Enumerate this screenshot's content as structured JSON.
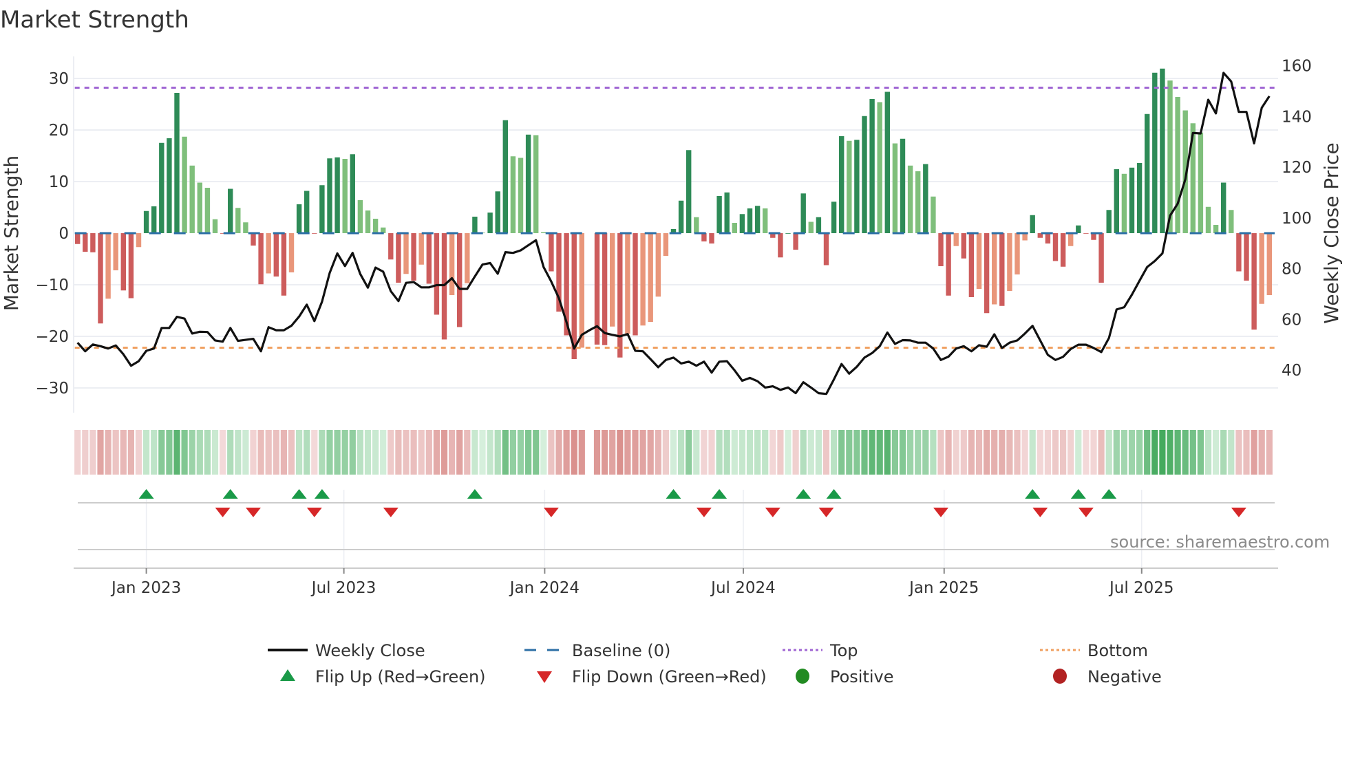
{
  "chart_data": {
    "type": "bar",
    "title": "Market Strength",
    "ylabel": "Market Strength",
    "y2label": "Weekly Close Price",
    "ylim": [
      -35,
      35
    ],
    "y_ticks": [
      30,
      20,
      10,
      0,
      -10,
      -20,
      -30
    ],
    "y_tick_labels": [
      "30",
      "20",
      "10",
      "0",
      "−10",
      "−20",
      "−30"
    ],
    "y2lim": [
      30,
      165
    ],
    "y2_ticks": [
      40,
      60,
      80,
      100,
      120,
      140,
      160
    ],
    "y2_tick_labels": [
      "40",
      "60",
      "80",
      "100",
      "120",
      "140",
      "160"
    ],
    "x_start_week": "2022-10-30",
    "x_ticks": [
      {
        "date": "2023-01-01",
        "label": "Jan 2023"
      },
      {
        "date": "2023-07-01",
        "label": "Jul 2023"
      },
      {
        "date": "2024-01-01",
        "label": "Jan 2024"
      },
      {
        "date": "2024-07-01",
        "label": "Jul 2024"
      },
      {
        "date": "2025-01-01",
        "label": "Jan 2025"
      },
      {
        "date": "2025-07-01",
        "label": "Jul 2025"
      }
    ],
    "top_level": 28.2,
    "bottom_level": -22.2,
    "baseline": 0,
    "grid": true,
    "legend_position": "bottom",
    "series": [
      {
        "name": "Market Strength",
        "values": [
          -2.1,
          -3.6,
          -3.7,
          -17.5,
          -12.7,
          -7.2,
          -11.1,
          -12.6,
          -2.7,
          4.3,
          5.2,
          17.5,
          18.4,
          27.2,
          18.7,
          13.1,
          9.8,
          8.8,
          2.7,
          -0.1,
          8.6,
          4.9,
          2.1,
          -2.4,
          -9.9,
          -7.8,
          -8.4,
          -12.1,
          -7.6,
          5.6,
          8.2,
          -0.1,
          9.3,
          14.5,
          14.7,
          14.4,
          15.3,
          6.4,
          4.4,
          2.8,
          1.1,
          -5.1,
          -9.6,
          -7.9,
          -9.2,
          -6.1,
          -9.8,
          -15.8,
          -20.6,
          -12.0,
          -18.2,
          -9.7,
          3.2,
          0.1,
          4.0,
          8.1,
          21.9,
          14.9,
          14.6,
          19.1,
          19.0,
          0.2,
          -7.4,
          -15.2,
          -19.8,
          -24.4,
          -22.2,
          null,
          -21.6,
          -21.7,
          -18.1,
          -24.1,
          -19.5,
          -19.8,
          -17.9,
          -17.2,
          -12.3,
          -4.4,
          0.8,
          6.3,
          16.1,
          3.1,
          -1.6,
          -2.0,
          7.2,
          7.9,
          2.0,
          3.7,
          4.8,
          5.3,
          4.8,
          -0.9,
          -4.7,
          0,
          -3.2,
          7.7,
          2.2,
          3.1,
          -6.2,
          6.1,
          18.8,
          17.9,
          18.1,
          22.7,
          26.0,
          25.4,
          27.4,
          17.4,
          18.3,
          13.1,
          12.0,
          13.4,
          7.1,
          -6.4,
          -12.1,
          -2.5,
          -4.9,
          -12.4,
          -10.8,
          -15.5,
          -13.8,
          -14.1,
          -11.2,
          -8.0,
          -1.4,
          3.5,
          -0.9,
          -2.0,
          -5.4,
          -6.5,
          -2.5,
          1.5,
          -0.1,
          -1.3,
          -9.6,
          4.5,
          12.4,
          11.5,
          12.7,
          13.6,
          23.1,
          31.1,
          31.9,
          29.6,
          26.4,
          23.8,
          21.3,
          19.5,
          5.1,
          1.6,
          9.8,
          4.5,
          -7.4,
          -9.2,
          -18.7,
          -13.7,
          -12.0
        ]
      },
      {
        "name": "Weekly Close",
        "axis": "right",
        "values": [
          50.8,
          47.4,
          50.1,
          49.4,
          48.5,
          49.7,
          46.2,
          41.7,
          43.5,
          47.6,
          48.5,
          56.6,
          56.6,
          61.0,
          60.3,
          54.4,
          55.1,
          55.0,
          51.7,
          51.2,
          56.6,
          51.5,
          51.9,
          52.3,
          47.4,
          56.9,
          55.7,
          55.7,
          57.5,
          61.1,
          65.8,
          59.3,
          67.0,
          78.3,
          86.0,
          81.0,
          86.2,
          77.9,
          72.5,
          80.4,
          78.8,
          71.1,
          67.2,
          74.4,
          74.7,
          72.6,
          72.6,
          73.5,
          73.5,
          76.2,
          72.0,
          72.0,
          76.9,
          81.6,
          82.2,
          78.0,
          86.5,
          86.2,
          87.2,
          89.2,
          91.2,
          80.6,
          74.9,
          68.4,
          58.9,
          48.5,
          53.9,
          55.7,
          57.3,
          54.6,
          53.9,
          53.3,
          54.2,
          47.6,
          47.4,
          44.3,
          41.1,
          44.0,
          44.9,
          42.6,
          43.3,
          41.7,
          43.3,
          39.0,
          43.3,
          43.5,
          39.9,
          35.8,
          36.9,
          35.6,
          33.1,
          33.6,
          32.2,
          33.1,
          30.9,
          35.2,
          33.1,
          30.9,
          30.6,
          36.3,
          42.4,
          38.6,
          41.3,
          44.9,
          46.7,
          49.4,
          54.8,
          50.3,
          51.8,
          51.7,
          50.8,
          50.8,
          48.5,
          44.0,
          45.3,
          48.5,
          49.4,
          47.4,
          49.8,
          49.2,
          54.1,
          48.7,
          50.8,
          51.7,
          54.4,
          57.4,
          51.7,
          46.0,
          44.0,
          45.2,
          48.3,
          50.0,
          50.0,
          48.7,
          47.1,
          52.6,
          63.9,
          64.8,
          69.7,
          75.2,
          80.6,
          83.0,
          86.0,
          100.9,
          105.6,
          115.2,
          133.5,
          133.3,
          146.6,
          141.2,
          157.2,
          153.8,
          141.8,
          141.8,
          129.4,
          143.4,
          148.0
        ]
      }
    ],
    "flip_up_weeks": [
      10,
      21,
      30,
      33,
      53,
      79,
      85,
      96,
      100,
      126,
      132,
      136
    ],
    "flip_down_weeks": [
      20,
      24,
      32,
      42,
      63,
      83,
      92,
      99,
      114,
      127,
      133,
      153
    ],
    "legend": [
      {
        "label": "Weekly Close",
        "symbol": "line-solid",
        "color": "#111111"
      },
      {
        "label": "Baseline (0)",
        "symbol": "line-dashed",
        "color": "#2c6fa6"
      },
      {
        "label": "Top",
        "symbol": "line-dotted",
        "color": "#a066d3"
      },
      {
        "label": "Bottom",
        "symbol": "line-dotted",
        "color": "#f0a060"
      },
      {
        "label": "Flip Up (Red→Green)",
        "symbol": "triangle-up",
        "color": "#1a9a48"
      },
      {
        "label": "Flip Down (Green→Red)",
        "symbol": "triangle-down",
        "color": "#d62728"
      },
      {
        "label": "Positive",
        "symbol": "circle",
        "color": "#228b22"
      },
      {
        "label": "Negative",
        "symbol": "circle",
        "color": "#b22222"
      }
    ],
    "source": "source: sharemaestro.com"
  },
  "colors": {
    "pos_strong": "#2e8b57",
    "pos_weak": "#7fbf7b",
    "neg_strong": "#cd5c5c",
    "neg_weak": "#e9967a",
    "grid": "#eceef3"
  }
}
